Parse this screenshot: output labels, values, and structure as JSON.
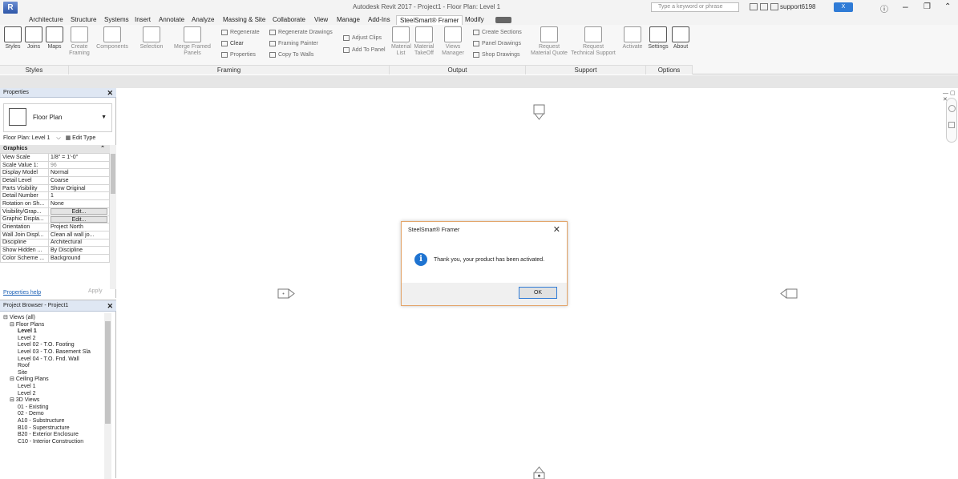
{
  "titlebar": {
    "title": "Autodesk Revit 2017 -    Project1 - Floor Plan: Level 1",
    "search_placeholder": "Type a keyword or phrase",
    "user": "support6198",
    "logo": "R"
  },
  "tabs": [
    "Architecture",
    "Structure",
    "Systems",
    "Insert",
    "Annotate",
    "Analyze",
    "Massing & Site",
    "Collaborate",
    "View",
    "Manage",
    "Add-Ins",
    "SteelSmart® Framer",
    "Modify"
  ],
  "active_tab": "SteelSmart® Framer",
  "ribbon": {
    "styles_panel": {
      "buttons": [
        "Styles",
        "Joins",
        "Maps"
      ],
      "label": "Styles"
    },
    "framing_panel": {
      "buttons": [
        "Create Framing",
        "Components",
        "Selection",
        "Merge Framed Panels"
      ],
      "small_buttons": [
        "Regenerate",
        "Clear",
        "Properties",
        "Regenerate Drawings",
        "Framing Painter",
        "Copy To Walls",
        "Adjust Clips",
        "Add To Panel"
      ],
      "label": "Framing"
    },
    "output_panel": {
      "buttons": [
        "Material List",
        "Material TakeOff",
        "Views Manager"
      ],
      "small_buttons": [
        "Create Sections",
        "Panel Drawings",
        "Shop Drawings"
      ],
      "label": "Output"
    },
    "support_panel": {
      "buttons": [
        "Request Material Quote",
        "Request Technical Support",
        "Activate"
      ],
      "label": "Support"
    },
    "options_panel": {
      "buttons": [
        "Settings",
        "About"
      ],
      "label": "Options"
    }
  },
  "properties": {
    "header": "Properties",
    "type_name": "Floor Plan",
    "instance_label": "Floor Plan: Level 1",
    "edit_type": "Edit Type",
    "category": "Graphics",
    "rows": [
      {
        "k": "View Scale",
        "v": "1/8\" = 1'-0\""
      },
      {
        "k": "Scale Value  1:",
        "v": "96"
      },
      {
        "k": "Display Model",
        "v": "Normal"
      },
      {
        "k": "Detail Level",
        "v": "Coarse"
      },
      {
        "k": "Parts Visibility",
        "v": "Show Original"
      },
      {
        "k": "Detail Number",
        "v": "1"
      },
      {
        "k": "Rotation on Sh...",
        "v": "None"
      },
      {
        "k": "Visibility/Grap...",
        "v": "Edit..."
      },
      {
        "k": "Graphic Displa...",
        "v": "Edit..."
      },
      {
        "k": "Orientation",
        "v": "Project North"
      },
      {
        "k": "Wall Join Displ...",
        "v": "Clean all wall jo..."
      },
      {
        "k": "Discipline",
        "v": "Architectural"
      },
      {
        "k": "Show Hidden ...",
        "v": "By Discipline"
      },
      {
        "k": "Color Scheme ...",
        "v": "Background"
      }
    ],
    "help_link": "Properties help",
    "apply": "Apply"
  },
  "browser": {
    "header": "Project Browser - Project1",
    "tree": [
      {
        "t": "Views (all)",
        "lvl": 0,
        "b": false
      },
      {
        "t": "Floor Plans",
        "lvl": 1,
        "b": false
      },
      {
        "t": "Level 1",
        "lvl": 2,
        "b": true
      },
      {
        "t": "Level 2",
        "lvl": 2,
        "b": false
      },
      {
        "t": "Level 02 - T.O. Footing",
        "lvl": 2,
        "b": false
      },
      {
        "t": "Level 03 - T.O. Basement Sla",
        "lvl": 2,
        "b": false
      },
      {
        "t": "Level 04 - T.O. Fnd. Wall",
        "lvl": 2,
        "b": false
      },
      {
        "t": "Roof",
        "lvl": 2,
        "b": false
      },
      {
        "t": "Site",
        "lvl": 2,
        "b": false
      },
      {
        "t": "Ceiling Plans",
        "lvl": 1,
        "b": false
      },
      {
        "t": "Level 1",
        "lvl": 2,
        "b": false
      },
      {
        "t": "Level 2",
        "lvl": 2,
        "b": false
      },
      {
        "t": "3D Views",
        "lvl": 1,
        "b": false
      },
      {
        "t": "01 - Existing",
        "lvl": 2,
        "b": false
      },
      {
        "t": "02 - Demo",
        "lvl": 2,
        "b": false
      },
      {
        "t": "A10 - Substructure",
        "lvl": 2,
        "b": false
      },
      {
        "t": "B10 - Superstructure",
        "lvl": 2,
        "b": false
      },
      {
        "t": "B20 - Exterior Enclosure",
        "lvl": 2,
        "b": false
      },
      {
        "t": "C10 - Interior Construction",
        "lvl": 2,
        "b": false
      }
    ]
  },
  "dialog": {
    "title": "SteelSmart® Framer",
    "message": "Thank you, your product has been activated.",
    "ok": "OK"
  }
}
